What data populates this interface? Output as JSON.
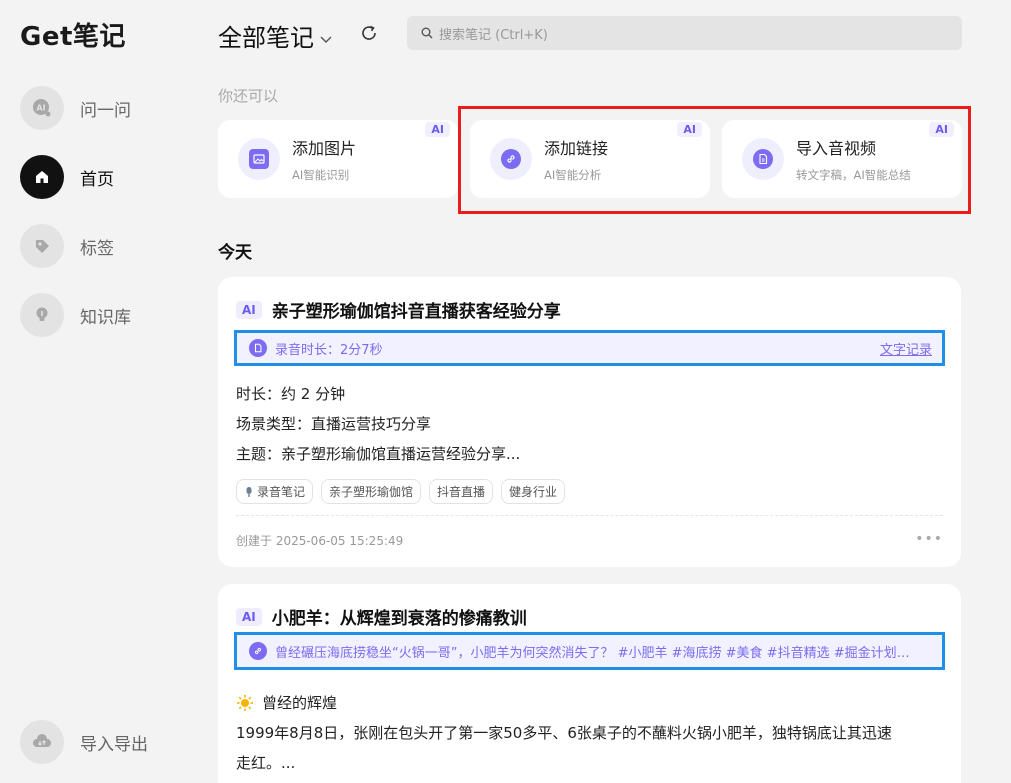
{
  "app": {
    "logo": "Get笔记"
  },
  "sidebar": {
    "items": [
      {
        "label": "问一问",
        "icon": "ai-chat-icon"
      },
      {
        "label": "首页",
        "icon": "home-icon",
        "active": true
      },
      {
        "label": "标签",
        "icon": "tag-icon"
      },
      {
        "label": "知识库",
        "icon": "lightbulb-icon"
      }
    ],
    "bottom": {
      "label": "导入导出",
      "icon": "import-export-icon"
    }
  },
  "header": {
    "title": "全部笔记",
    "search_placeholder": "搜索笔记 (Ctrl+K)"
  },
  "hint": "你还可以",
  "actions": [
    {
      "title": "添加图片",
      "subtitle": "AI智能识别",
      "badge": "AI",
      "icon": "image-icon"
    },
    {
      "title": "添加链接",
      "subtitle": "AI智能分析",
      "badge": "AI",
      "icon": "link-icon"
    },
    {
      "title": "导入音视频",
      "subtitle": "转文字稿，AI智能总结",
      "badge": "AI",
      "icon": "audio-file-icon"
    }
  ],
  "section_today": "今天",
  "notes": [
    {
      "ai_tag": "AI",
      "title": "亲子塑形瑜伽馆抖音直播获客经验分享",
      "info": "录音时长：2分7秒",
      "info_link": "文字记录",
      "lines": [
        "时长：约 2 分钟",
        "场景类型：直播运营技巧分享",
        "主题：亲子塑形瑜伽馆直播运营经验分享..."
      ],
      "tags": [
        "录音笔记",
        "亲子塑形瑜伽馆",
        "抖音直播",
        "健身行业"
      ],
      "created": "创建于 2025-06-05 15:25:49",
      "more": "•••"
    },
    {
      "ai_tag": "AI",
      "title": "小肥羊：从辉煌到衰落的惨痛教训",
      "info": "曾经碾压海底捞稳坐“火锅一哥”，小肥羊为何突然消失了？ #小肥羊 #海底捞 #美食 #抖音精选 #掘金计划…",
      "sub_heading": "曾经的辉煌",
      "paragraph_1": "1999年8月8日，张刚在包头开了第一家50多平、6张桌子的不蘸料火锅小肥羊，独特锅底让其迅速",
      "paragraph_2": "走红。..."
    }
  ],
  "colors": {
    "accent": "#7c6cf2",
    "highlight_red": "#e81e1e",
    "highlight_blue": "#1e90e8"
  }
}
